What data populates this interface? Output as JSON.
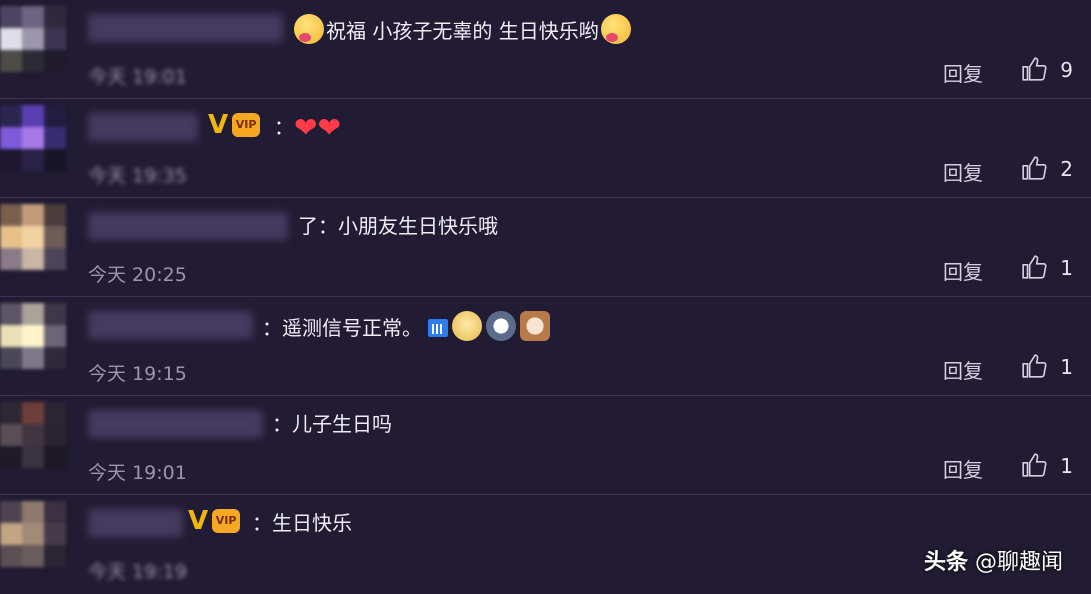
{
  "comments": [
    {
      "text": "祝福  小孩子无辜的 生日快乐哟",
      "time": "今天 19:01",
      "reply": "回复",
      "likes": "9",
      "vip": false
    },
    {
      "text": "：",
      "time": "今天 19:35",
      "reply": "回复",
      "likes": "2",
      "vip": true
    },
    {
      "text": "了：小朋友生日快乐哦",
      "time": "今天 20:25",
      "reply": "回复",
      "likes": "1",
      "vip": false
    },
    {
      "text": "：遥测信号正常。",
      "time": "今天 19:15",
      "reply": "回复",
      "likes": "1",
      "vip": false
    },
    {
      "text": "：儿子生日吗",
      "time": "今天 19:01",
      "reply": "回复",
      "likes": "1",
      "vip": false
    },
    {
      "text": "：生日快乐",
      "time": "今天 19:19",
      "reply": "回复",
      "likes": "",
      "vip": true
    }
  ],
  "badges": {
    "vip_label": "V",
    "crown_label": "VIP"
  },
  "watermark": {
    "brand": "头条",
    "account": "@聊趣闻"
  },
  "icons": {
    "like": "thumbs-up-icon",
    "emoji": "emoji-icon"
  },
  "colors": {
    "background": "#211b33",
    "vip": "#f2b705",
    "heart": "#ff3b4a"
  }
}
